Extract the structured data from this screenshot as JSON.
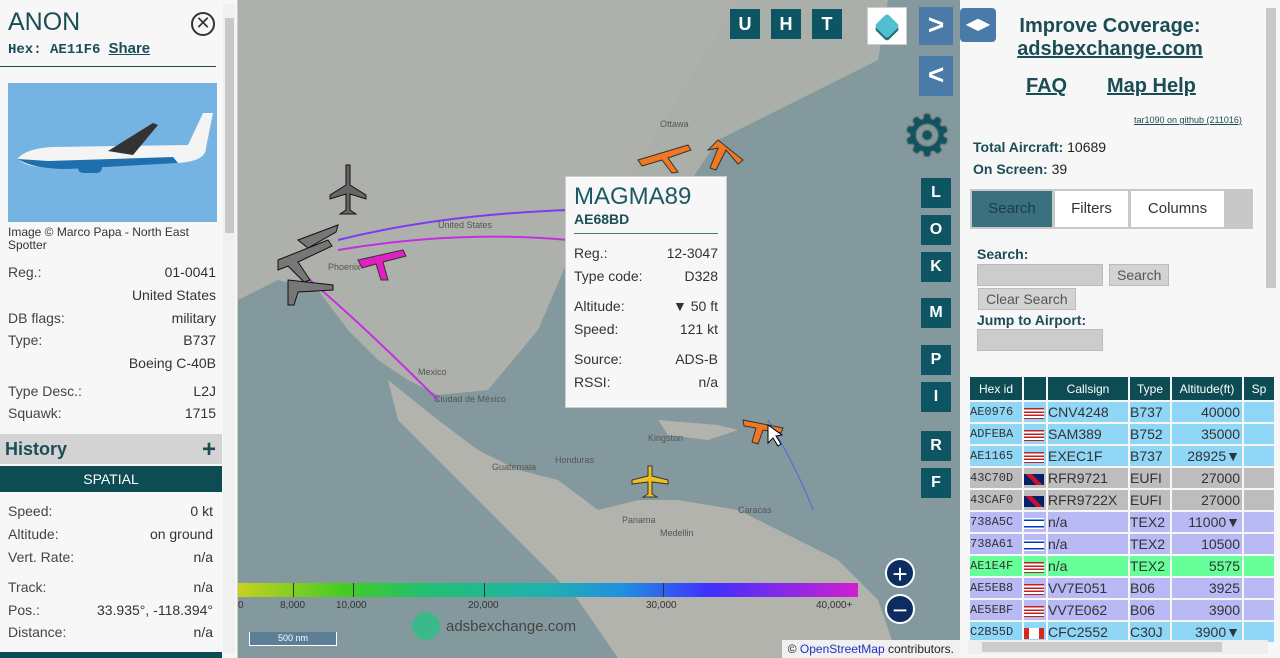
{
  "selected": {
    "title": "ANON",
    "hex_label": "Hex:",
    "hex": "AE11F6",
    "share": "Share",
    "photo_credit": "Image © Marco Papa - North East Spotter",
    "fields": [
      {
        "label": "Reg.:",
        "value": "01-0041"
      },
      {
        "label": "",
        "value": "United States"
      },
      {
        "label": "DB flags:",
        "value": "military"
      },
      {
        "label": "Type:",
        "value": "B737"
      },
      {
        "label": "",
        "value": "Boeing C-40B"
      },
      {
        "label": "Type Desc.:",
        "value": "L2J"
      },
      {
        "label": "Squawk:",
        "value": "1715"
      }
    ],
    "history": "History",
    "history_icon": "plus-icon",
    "spatial": "SPATIAL",
    "spatial_fields": [
      {
        "label": "Speed:",
        "value": "0 kt"
      },
      {
        "label": "Altitude:",
        "value": "on ground"
      },
      {
        "label": "Vert. Rate:",
        "value": "n/a"
      },
      {
        "label": "Track:",
        "value": "n/a"
      },
      {
        "label": "Pos.:",
        "value": "33.935°, -118.394°"
      },
      {
        "label": "Distance:",
        "value": "n/a"
      }
    ]
  },
  "map": {
    "top_buttons": [
      "U",
      "H",
      "T"
    ],
    "side_buttons": [
      "L",
      "O",
      "K",
      "M",
      "P",
      "I",
      "R",
      "F"
    ],
    "labels": [
      "Ottawa",
      "United States",
      "Phoenix",
      "Mexico",
      "Ciudad de México",
      "Kingston",
      "Guatemala",
      "Honduras",
      "Panama",
      "Caracas",
      "Medellin"
    ],
    "tooltip": {
      "callsign": "MAGMA89",
      "hex": "AE68BD",
      "rows": [
        {
          "label": "Reg.:",
          "value": "12-3047"
        },
        {
          "label": "Type code:",
          "value": "D328"
        },
        {
          "label": "Altitude:",
          "value": "▼ 50 ft"
        },
        {
          "label": "Speed:",
          "value": "121 kt"
        },
        {
          "label": "Source:",
          "value": "ADS-B"
        },
        {
          "label": "RSSI:",
          "value": "n/a"
        }
      ]
    },
    "legend_ticks": [
      "0",
      "8,000",
      "10,000",
      "20,000",
      "30,000",
      "40,000+"
    ],
    "scale": "500 nm",
    "watermark": "adsbexchange.com",
    "attribution_prefix": "©",
    "attribution_link": "OpenStreetMap",
    "attribution_suffix": "contributors.",
    "zoom_in": "+",
    "zoom_out": "−"
  },
  "right": {
    "improve": "Improve Coverage:",
    "site": "adsbexchange.com",
    "faq": "FAQ",
    "help": "Map Help",
    "github": "tar1090 on github (211016)",
    "total_label": "Total Aircraft:",
    "total": "10689",
    "onscreen_label": "On Screen:",
    "onscreen": "39",
    "tabs": [
      "Search",
      "Filters",
      "Columns"
    ],
    "search_label": "Search:",
    "search_btn": "Search",
    "clear_btn": "Clear Search",
    "jump_label": "Jump to Airport:"
  },
  "table": {
    "headers": [
      "Hex id",
      "",
      "Callsign",
      "Type",
      "Altitude(ft)",
      "Sp"
    ],
    "rows": [
      {
        "hex": "AE0976",
        "flag": "us",
        "callsign": "CNV4248",
        "type": "B737",
        "alt": "40000",
        "color": "#8fd6f7"
      },
      {
        "hex": "ADFEBA",
        "flag": "us",
        "callsign": "SAM389",
        "type": "B752",
        "alt": "35000",
        "color": "#8fd6f7"
      },
      {
        "hex": "AE1165",
        "flag": "us",
        "callsign": "EXEC1F",
        "type": "B737",
        "alt": "28925▼",
        "color": "#8fd6f7"
      },
      {
        "hex": "43C70D",
        "flag": "gb",
        "callsign": "RFR9721",
        "type": "EUFI",
        "alt": "27000",
        "color": "#bdbdbd"
      },
      {
        "hex": "43CAF0",
        "flag": "gb",
        "callsign": "RFR9722X",
        "type": "EUFI",
        "alt": "27000",
        "color": "#bdbdbd"
      },
      {
        "hex": "738A5C",
        "flag": "il",
        "callsign": "n/a",
        "type": "TEX2",
        "alt": "11000▼",
        "color": "#b9b9f5"
      },
      {
        "hex": "738A61",
        "flag": "il",
        "callsign": "n/a",
        "type": "TEX2",
        "alt": "10500",
        "color": "#b9b9f5"
      },
      {
        "hex": "AE1E4F",
        "flag": "us",
        "callsign": "n/a",
        "type": "TEX2",
        "alt": "5575",
        "color": "#66ff99"
      },
      {
        "hex": "AE5EB8",
        "flag": "us",
        "callsign": "VV7E051",
        "type": "B06",
        "alt": "3925",
        "color": "#b9b9f5"
      },
      {
        "hex": "AE5EBF",
        "flag": "us",
        "callsign": "VV7E062",
        "type": "B06",
        "alt": "3900",
        "color": "#b9b9f5"
      },
      {
        "hex": "C2B55D",
        "flag": "ca",
        "callsign": "CFC2552",
        "type": "C30J",
        "alt": "3900▼",
        "color": "#8fd6f7"
      }
    ]
  }
}
